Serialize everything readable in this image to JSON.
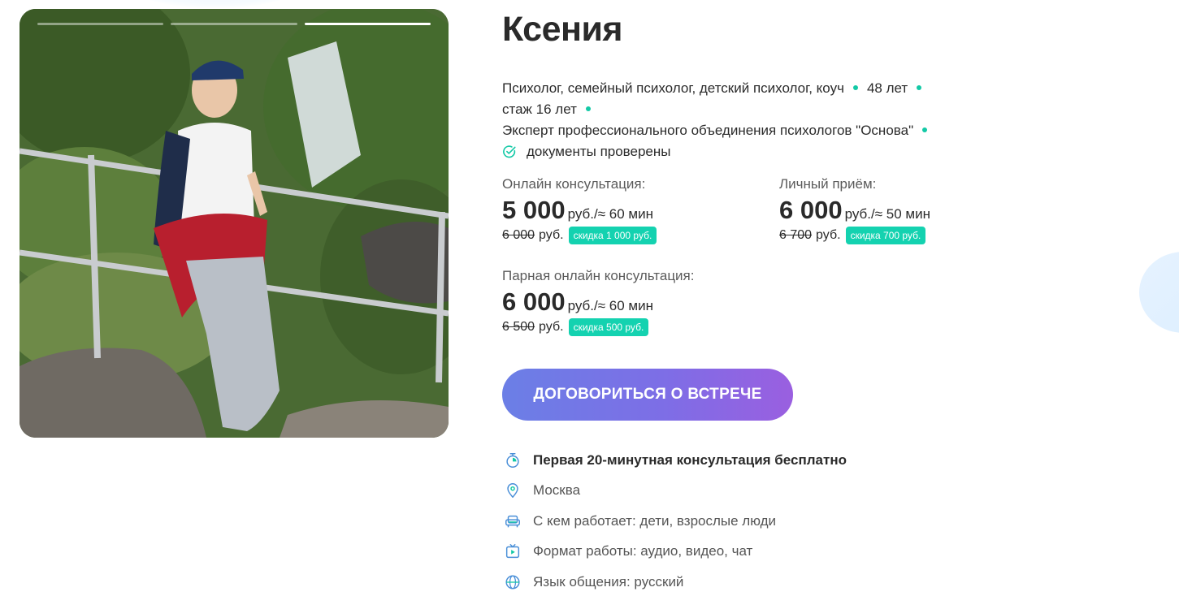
{
  "profile": {
    "name": "Ксения",
    "meta_line1_text": "Психолог, семейный психолог, детский психолог, коуч",
    "meta_age": "48 лет",
    "meta_experience": "стаж 16 лет",
    "meta_expert": "Эксперт профессионального объединения психологов \"Основа\"",
    "verified": "документы проверены"
  },
  "gallery": {
    "slides_total": 3,
    "active_slide": 3
  },
  "prices": [
    {
      "label": "Онлайн консультация:",
      "amount": "5 000",
      "unit": "руб./≈ 60 мин",
      "old_amount": "6 000",
      "old_unit": "руб.",
      "discount": "скидка 1 000 руб."
    },
    {
      "label": "Личный приём:",
      "amount": "6 000",
      "unit": "руб./≈ 50 мин",
      "old_amount": "6 700",
      "old_unit": "руб.",
      "discount": "скидка 700 руб."
    },
    {
      "label": "Парная онлайн консультация:",
      "amount": "6 000",
      "unit": "руб./≈ 60 мин",
      "old_amount": "6 500",
      "old_unit": "руб.",
      "discount": "скидка 500 руб."
    }
  ],
  "cta": {
    "label": "ДОГОВОРИТЬСЯ О ВСТРЕЧЕ"
  },
  "features": [
    {
      "icon": "stopwatch-icon",
      "text": "Первая 20-минутная консультация бесплатно"
    },
    {
      "icon": "location-pin-icon",
      "text": "Москва"
    },
    {
      "icon": "armchair-icon",
      "text": "С кем работает: дети, взрослые люди"
    },
    {
      "icon": "video-play-icon",
      "text": "Формат работы: аудио, видео, чат"
    },
    {
      "icon": "globe-icon",
      "text": "Язык общения: русский"
    }
  ],
  "colors": {
    "accent_teal": "#13c9a6",
    "cta_gradient_start": "#6b7fe6",
    "cta_gradient_end": "#9a5fe0",
    "icon_blue": "#4a8fd8"
  }
}
